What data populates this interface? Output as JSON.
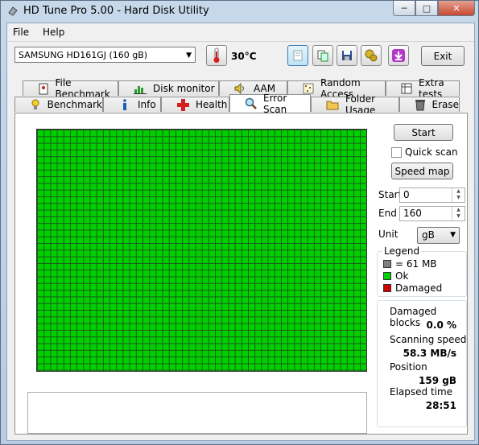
{
  "window": {
    "title": "HD Tune Pro 5.00 - Hard Disk Utility",
    "min": "─",
    "max": "□",
    "close": "✕"
  },
  "menu": {
    "file": "File",
    "help": "Help"
  },
  "toolbar": {
    "drive": "SAMSUNG HD161GJ (160 gB)",
    "temperature": "30°C",
    "exit_label": "Exit"
  },
  "tabs_top": [
    {
      "label": "File Benchmark",
      "icon": "file-benchmark-icon"
    },
    {
      "label": "Disk monitor",
      "icon": "disk-monitor-icon"
    },
    {
      "label": "AAM",
      "icon": "speaker-icon"
    },
    {
      "label": "Random Access",
      "icon": "random-access-icon"
    },
    {
      "label": "Extra tests",
      "icon": "extra-tests-icon"
    }
  ],
  "tabs_bottom": [
    {
      "label": "Benchmark",
      "icon": "lightbulb-icon"
    },
    {
      "label": "Info",
      "icon": "info-icon"
    },
    {
      "label": "Health",
      "icon": "health-cross-icon"
    },
    {
      "label": "Error Scan",
      "icon": "magnifier-icon"
    },
    {
      "label": "Folder Usage",
      "icon": "folder-icon"
    },
    {
      "label": "Erase",
      "icon": "trash-icon"
    }
  ],
  "scan": {
    "start_button": "Start",
    "quick_scan": "Quick scan",
    "quick_scan_checked": false,
    "speed_map_button": "Speed map",
    "start_label": "Start",
    "start_value": "0",
    "end_label": "End",
    "end_value": "160",
    "unit_label": "Unit",
    "unit_value": "gB",
    "grid_block_status": "ok"
  },
  "legend": {
    "title": "Legend",
    "block_size": "= 61 MB",
    "ok": "Ok",
    "damaged": "Damaged",
    "colors": {
      "block": "#808080",
      "ok": "#00d000",
      "damaged": "#d00000"
    }
  },
  "stats": {
    "damaged_blocks_label": "Damaged blocks",
    "damaged_blocks_value": "0.0 %",
    "scanning_speed_label": "Scanning speed",
    "scanning_speed_value": "58.3 MB/s",
    "position_label": "Position",
    "position_value": "159 gB",
    "elapsed_label": "Elapsed time",
    "elapsed_value": "28:51"
  }
}
